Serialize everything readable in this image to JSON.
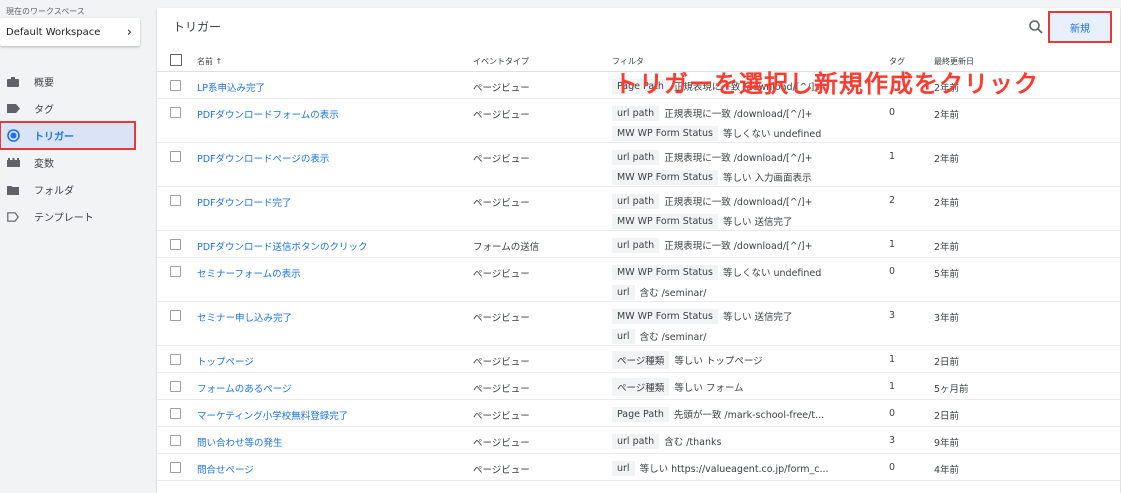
{
  "sidebar": {
    "workspace_label": "現在のワークスペース",
    "workspace_name": "Default Workspace",
    "items": [
      {
        "label": "概要",
        "icon": "briefcase-icon"
      },
      {
        "label": "タグ",
        "icon": "tag-icon"
      },
      {
        "label": "トリガー",
        "icon": "trigger-icon"
      },
      {
        "label": "変数",
        "icon": "variable-icon"
      },
      {
        "label": "フォルダ",
        "icon": "folder-icon"
      },
      {
        "label": "テンプレート",
        "icon": "template-icon"
      }
    ],
    "active_index": 2
  },
  "main": {
    "title": "トリガー",
    "new_button": "新規",
    "annotation": "トリガーを選択し新規作成をクリック",
    "columns": {
      "name": "名前 ↑",
      "event": "イベントタイプ",
      "filter": "フィルタ",
      "tag": "タグ",
      "updated": "最終更新日"
    },
    "rows": [
      {
        "name": "LP系申込み完了",
        "event": "ページビュー",
        "filters": [
          {
            "chip": "Page Path",
            "text": "正規表現に一致 /download/[^/]+"
          }
        ],
        "tags": "",
        "updated": "2年前"
      },
      {
        "name": "PDFダウンロードフォームの表示",
        "event": "ページビュー",
        "filters": [
          {
            "chip": "url path",
            "text": "正規表現に一致 /download/[^/]+"
          },
          {
            "chip": "MW WP Form Status",
            "text": "等しくない undefined"
          }
        ],
        "tags": "0",
        "updated": "2年前"
      },
      {
        "name": "PDFダウンロードページの表示",
        "event": "ページビュー",
        "filters": [
          {
            "chip": "url path",
            "text": "正規表現に一致 /download/[^/]+"
          },
          {
            "chip": "MW WP Form Status",
            "text": "等しい 入力画面表示"
          }
        ],
        "tags": "1",
        "updated": "2年前"
      },
      {
        "name": "PDFダウンロード完了",
        "event": "ページビュー",
        "filters": [
          {
            "chip": "url path",
            "text": "正規表現に一致 /download/[^/]+"
          },
          {
            "chip": "MW WP Form Status",
            "text": "等しい 送信完了"
          }
        ],
        "tags": "2",
        "updated": "2年前"
      },
      {
        "name": "PDFダウンロード送信ボタンのクリック",
        "event": "フォームの送信",
        "filters": [
          {
            "chip": "url path",
            "text": "正規表現に一致 /download/[^/]+"
          }
        ],
        "tags": "1",
        "updated": "2年前"
      },
      {
        "name": "セミナーフォームの表示",
        "event": "ページビュー",
        "filters": [
          {
            "chip": "MW WP Form Status",
            "text": "等しくない undefined"
          },
          {
            "chip": "url",
            "text": "含む /seminar/"
          }
        ],
        "tags": "0",
        "updated": "5年前"
      },
      {
        "name": "セミナー申し込み完了",
        "event": "ページビュー",
        "filters": [
          {
            "chip": "MW WP Form Status",
            "text": "等しい 送信完了"
          },
          {
            "chip": "url",
            "text": "含む /seminar/"
          }
        ],
        "tags": "3",
        "updated": "3年前"
      },
      {
        "name": "トップページ",
        "event": "ページビュー",
        "filters": [
          {
            "chip": "ページ種類",
            "text": "等しい トップページ"
          }
        ],
        "tags": "1",
        "updated": "2日前"
      },
      {
        "name": "フォームのあるページ",
        "event": "ページビュー",
        "filters": [
          {
            "chip": "ページ種類",
            "text": "等しい フォーム"
          }
        ],
        "tags": "1",
        "updated": "5ヶ月前"
      },
      {
        "name": "マーケティング小学校無料登録完了",
        "event": "ページビュー",
        "filters": [
          {
            "chip": "Page Path",
            "text": "先頭が一致 /mark-school-free/t..."
          }
        ],
        "tags": "0",
        "updated": "2日前"
      },
      {
        "name": "問い合わせ等の発生",
        "event": "ページビュー",
        "filters": [
          {
            "chip": "url path",
            "text": "含む /thanks"
          }
        ],
        "tags": "3",
        "updated": "9年前"
      },
      {
        "name": "問合せページ",
        "event": "ページビュー",
        "filters": [
          {
            "chip": "url",
            "text": "等しい https://valueagent.co.jp/form_c..."
          }
        ],
        "tags": "0",
        "updated": "4年前"
      }
    ]
  }
}
